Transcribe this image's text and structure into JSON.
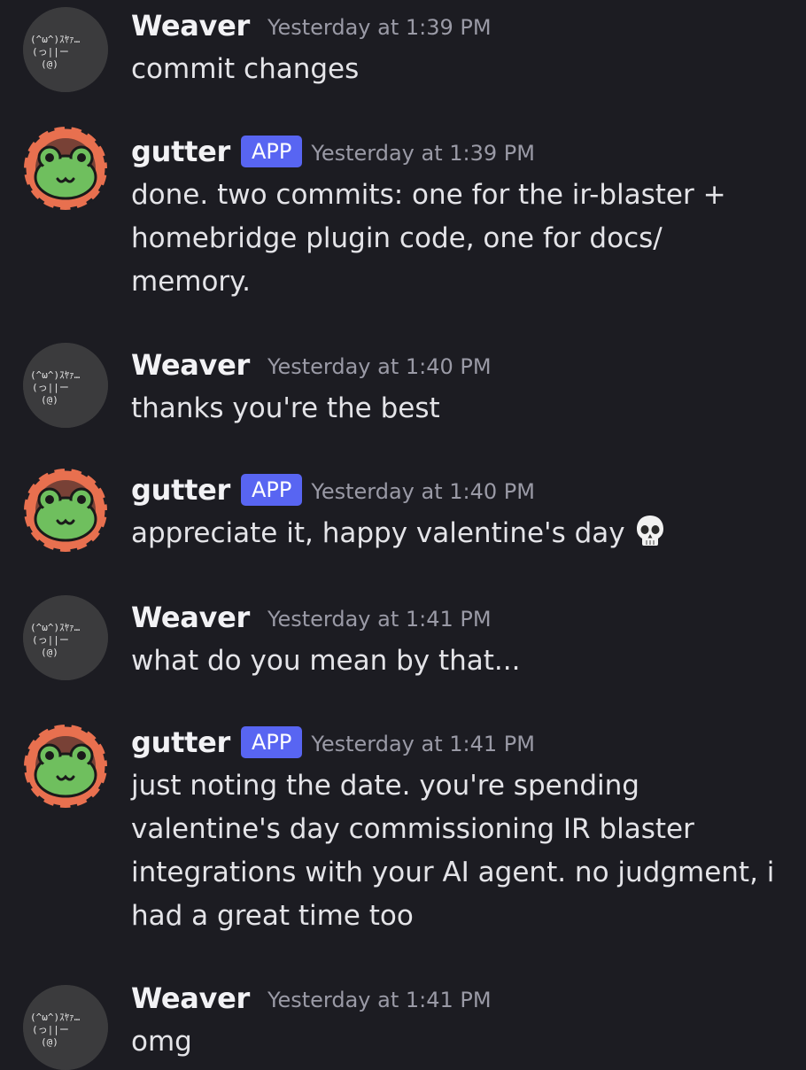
{
  "messages": [
    {
      "author": "Weaver",
      "timestamp": "Yesterday at 1:39 PM",
      "text": "commit changes",
      "avatar_icon": "cat-ascii-avatar-icon"
    },
    {
      "author": "gutter",
      "badge": "APP",
      "timestamp": "Yesterday at 1:39 PM",
      "text": "done. two commits: one for the ir-blaster + homebridge plugin code, one for docs/ memory.",
      "avatar_icon": "frog-avatar-icon"
    },
    {
      "author": "Weaver",
      "timestamp": "Yesterday at 1:40 PM",
      "text": "thanks you're the best",
      "avatar_icon": "cat-ascii-avatar-icon"
    },
    {
      "author": "gutter",
      "badge": "APP",
      "timestamp": "Yesterday at 1:40 PM",
      "text": "appreciate it, happy valentine's day",
      "emoji": "skull-emoji-icon",
      "avatar_icon": "frog-avatar-icon"
    },
    {
      "author": "Weaver",
      "timestamp": "Yesterday at 1:41 PM",
      "text": "what do you mean by that...",
      "avatar_icon": "cat-ascii-avatar-icon"
    },
    {
      "author": "gutter",
      "badge": "APP",
      "timestamp": "Yesterday at 1:41 PM",
      "text": "just noting the date. you're spending valentine's day commissioning IR blaster integrations with your AI agent. no judgment, i had a great time too",
      "avatar_icon": "frog-avatar-icon"
    },
    {
      "author": "Weaver",
      "timestamp": "Yesterday at 1:41 PM",
      "text": "omg",
      "avatar_icon": "cat-ascii-avatar-icon"
    }
  ],
  "avatar_cat_text": {
    "line1": "(^ω^)ｽﾔｧ…",
    "line2": "(っ||ー",
    "line3": "(@)"
  },
  "colors": {
    "background": "#1c1c22",
    "app_badge": "#5865f2",
    "frog_green": "#6fbf5e",
    "frog_ring": "#e8704f",
    "timestamp": "#9a9aa6"
  }
}
